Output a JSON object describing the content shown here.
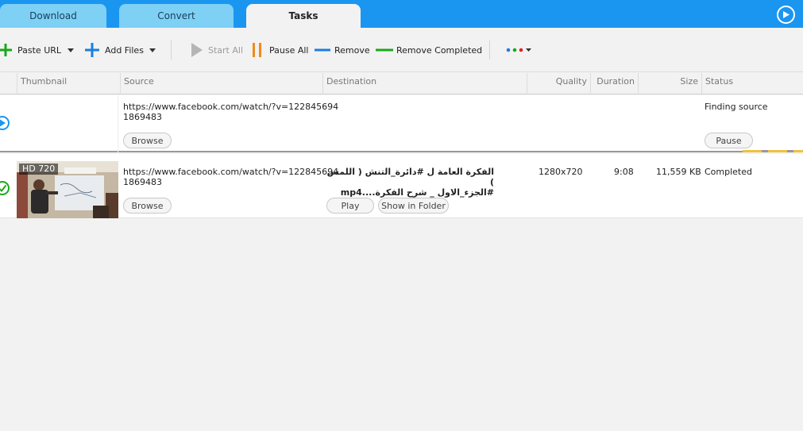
{
  "tabs": [
    {
      "label": "Download"
    },
    {
      "label": "Convert"
    },
    {
      "label": "Tasks"
    }
  ],
  "toolbar": {
    "paste_url": "Paste URL",
    "add_files": "Add Files",
    "start_all": "Start All",
    "pause_all": "Pause All",
    "remove": "Remove",
    "remove_completed": "Remove Completed"
  },
  "columns": {
    "thumbnail": "Thumbnail",
    "source": "Source",
    "destination": "Destination",
    "quality": "Quality",
    "duration": "Duration",
    "size": "Size",
    "status": "Status"
  },
  "tasks": [
    {
      "source_line1": "https://www.facebook.com/watch/?v=122845694",
      "source_line2": "1869483",
      "browse": "Browse",
      "status": "Finding source",
      "action": "Pause"
    },
    {
      "thumb_badge": "HD 720",
      "source_line1": "https://www.facebook.com/watch/?v=122845694",
      "source_line2": "1869483",
      "browse": "Browse",
      "destination_line1": "الفكرة العامة ل #دائرة_التنش ( اللمس )",
      "destination_line2": "#الجزء_الاول _ شرح الفكرة....mp4",
      "quality": "1280x720",
      "duration": "9:08",
      "size": "11,559 KB",
      "status": "Completed",
      "play": "Play",
      "show_in_folder": "Show in Folder"
    }
  ],
  "colors": {
    "tab_bar": "#1a96f0",
    "tab_inactive": "#7ed0f5",
    "add_green": "#1aa81a",
    "add_blue": "#1a7ee0",
    "pause_orange": "#f08a1c",
    "remove_blue": "#1a7ee0",
    "remove_completed_green": "#1aa81a"
  },
  "icons": [
    "help-icon",
    "plus-icon",
    "caret-down-icon",
    "play-icon",
    "pause-icon",
    "minus-icon",
    "more-dots-icon",
    "status-play-icon",
    "status-check-icon"
  ]
}
